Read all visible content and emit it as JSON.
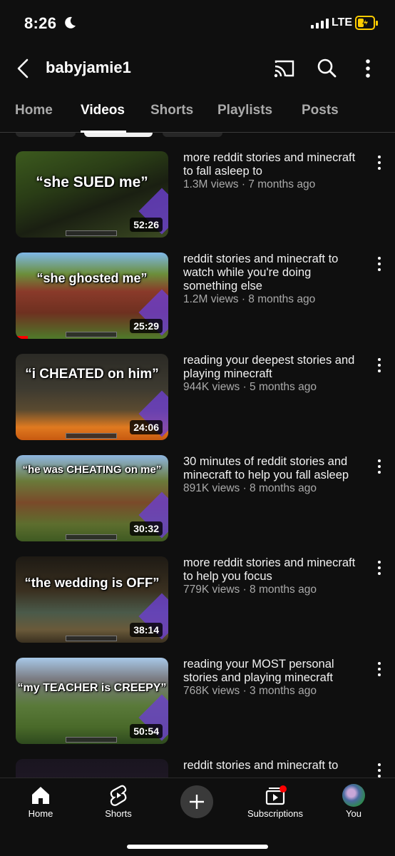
{
  "status_bar": {
    "time": "8:26",
    "network": "LTE"
  },
  "header": {
    "channel_name": "babyjamie1"
  },
  "tabs": [
    {
      "label": "Home",
      "active": false
    },
    {
      "label": "Videos",
      "active": true
    },
    {
      "label": "Shorts",
      "active": false
    },
    {
      "label": "Playlists",
      "active": false
    },
    {
      "label": "Posts",
      "active": false
    }
  ],
  "videos": [
    {
      "thumb_text": "“she SUED me”",
      "duration": "52:26",
      "title": "more reddit stories and minecraft to fall asleep to",
      "views": "1.3M views · 7 months ago"
    },
    {
      "thumb_text": "“she ghosted me”",
      "duration": "25:29",
      "title": "reddit stories and minecraft to watch while you're doing something else",
      "views": "1.2M views · 8 months ago",
      "watched_fraction": 0.08
    },
    {
      "thumb_text": "“i CHEATED on him”",
      "duration": "24:06",
      "title": "reading your deepest stories and playing minecraft",
      "views": "944K views · 5 months ago"
    },
    {
      "thumb_text": "“he was CHEATING on me”",
      "duration": "30:32",
      "title": "30 minutes of reddit stories and minecraft to help you fall asleep",
      "views": "891K views · 8 months ago"
    },
    {
      "thumb_text": "“the wedding is OFF”",
      "duration": "38:14",
      "title": "more reddit stories and minecraft to help you focus",
      "views": "779K views · 8 months ago"
    },
    {
      "thumb_text": "“my TEACHER is CREEPY”",
      "duration": "50:54",
      "title": "reading your MOST personal stories and playing minecraft",
      "views": "768K views · 3 months ago"
    },
    {
      "thumb_text": "",
      "duration": "",
      "title": "reddit stories and minecraft to",
      "views": ""
    }
  ],
  "bottom_nav": [
    {
      "label": "Home",
      "icon": "home-icon"
    },
    {
      "label": "Shorts",
      "icon": "shorts-icon"
    },
    {
      "label": "",
      "icon": "create-plus-icon"
    },
    {
      "label": "Subscriptions",
      "icon": "subscriptions-icon"
    },
    {
      "label": "You",
      "icon": "avatar"
    }
  ],
  "colors": {
    "background": "#0f0f0f",
    "text_secondary": "#aaaaaa",
    "accent_red": "#ff0000",
    "battery": "#ffcc00"
  }
}
